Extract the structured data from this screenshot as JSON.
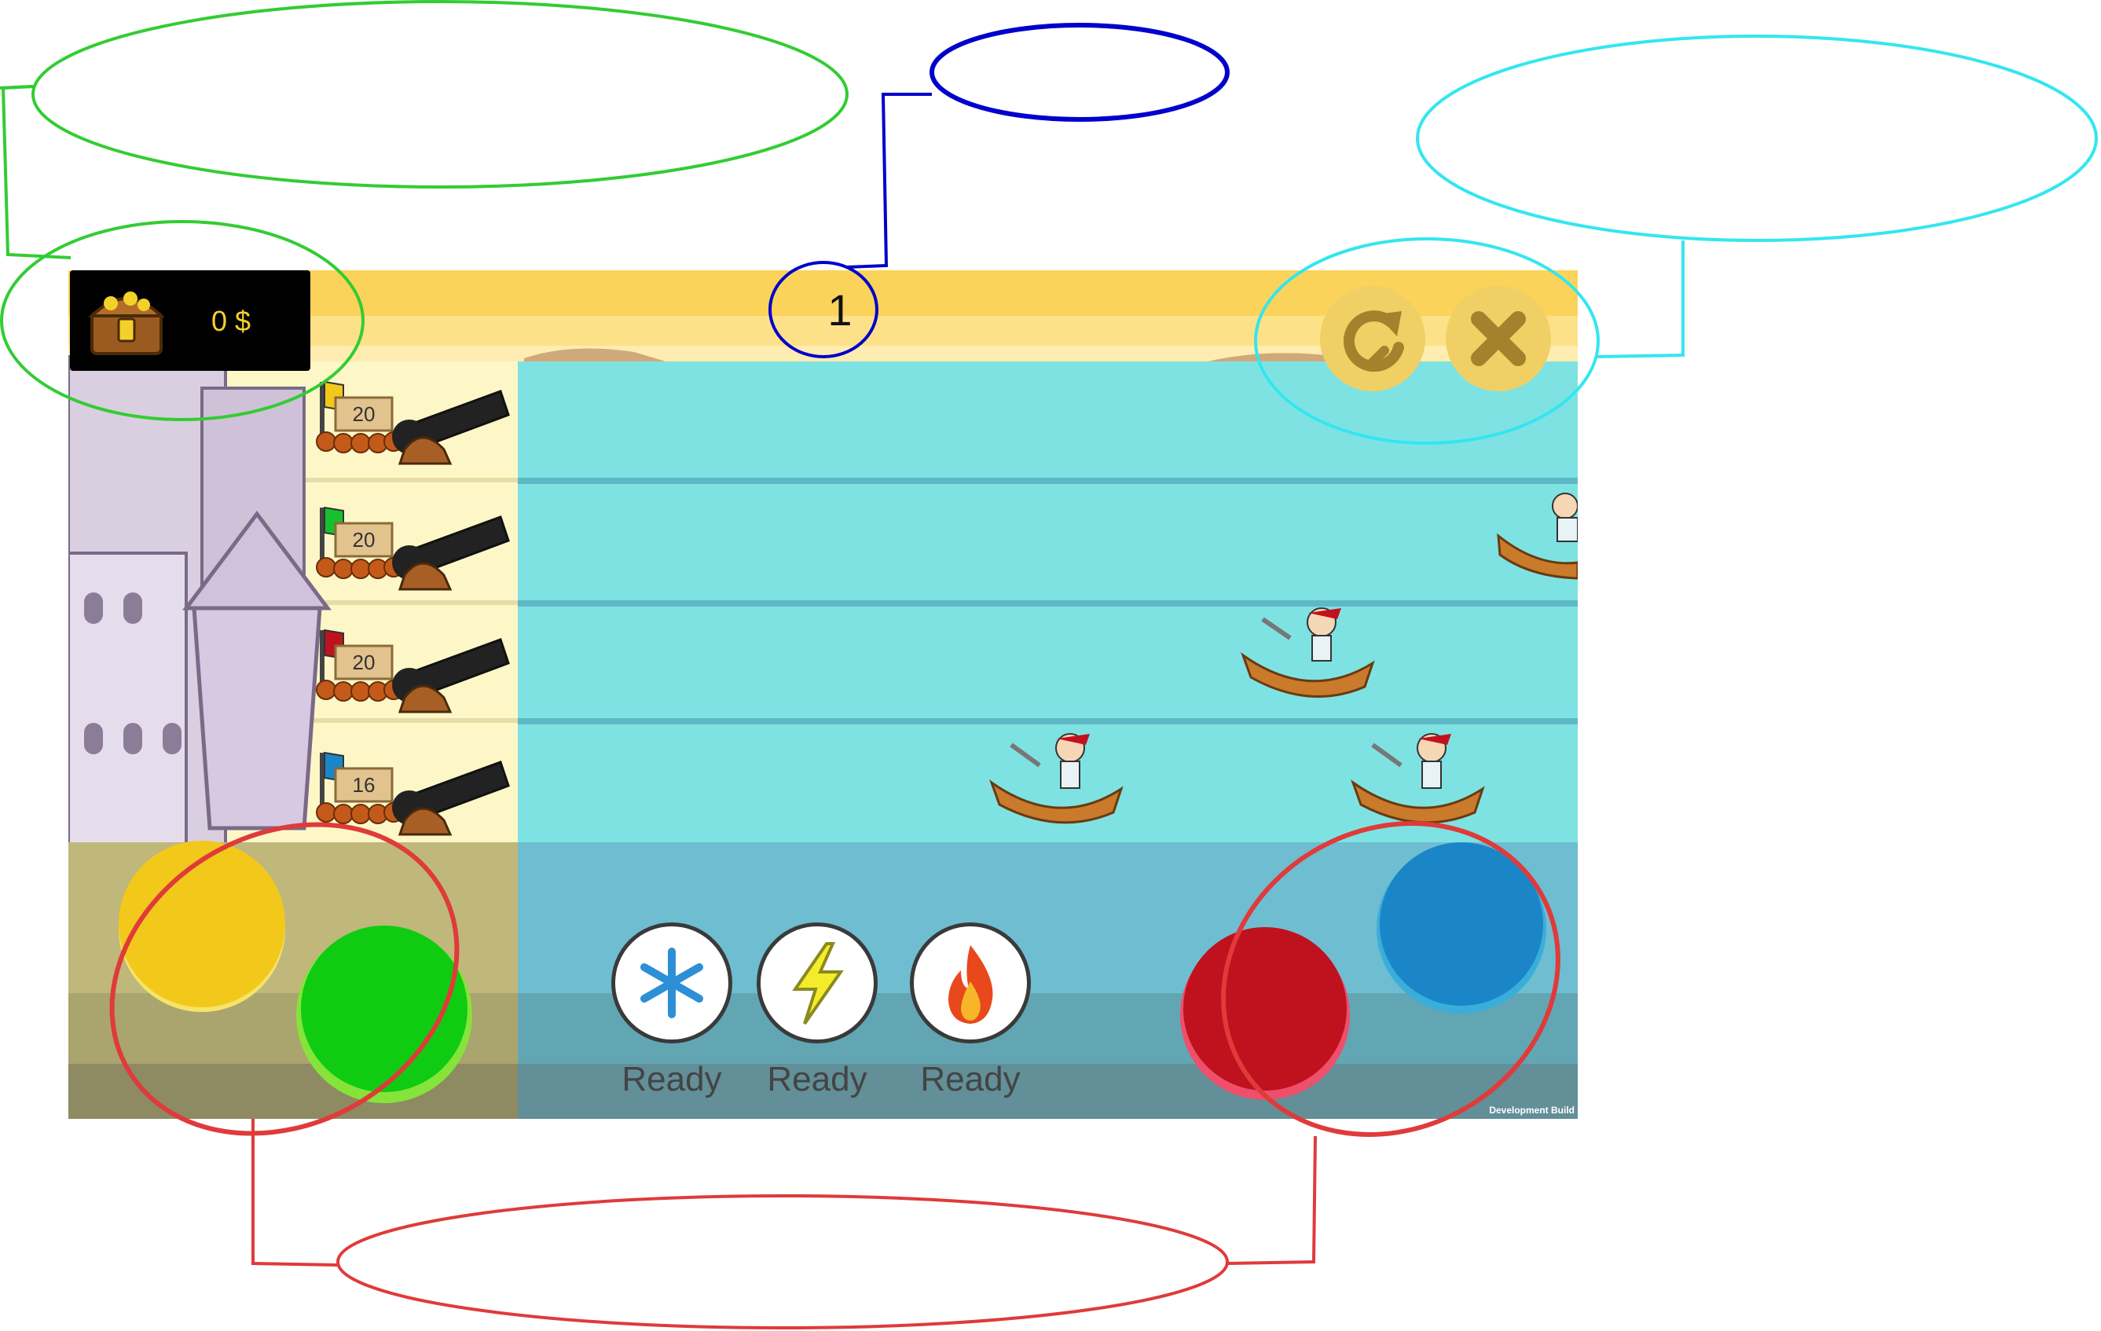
{
  "hud": {
    "money": "0 $",
    "round": "1"
  },
  "lanes": [
    {
      "color": "#f2c81a",
      "ammo": "20"
    },
    {
      "color": "#17c12d",
      "ammo": "20"
    },
    {
      "color": "#c0111f",
      "ammo": "20"
    },
    {
      "color": "#1a86c8",
      "ammo": "16"
    }
  ],
  "powerups": [
    {
      "icon": "snowflake-icon",
      "status": "Ready"
    },
    {
      "icon": "lightning-icon",
      "status": "Ready"
    },
    {
      "icon": "fire-icon",
      "status": "Ready"
    }
  ],
  "fire_buttons": {
    "yellow": "#f2c81a",
    "green": "#0fcc12",
    "red": "#c0111f",
    "blue": "#1a86c8"
  },
  "top_controls": [
    {
      "icon": "restart-icon"
    },
    {
      "icon": "close-icon"
    }
  ],
  "footer": {
    "build_label": "Development Build"
  },
  "annotation_colors": {
    "money": "#33cc33",
    "round": "#0000cc",
    "controls": "#33e6f0",
    "fire_buttons": "#e03a3a"
  }
}
